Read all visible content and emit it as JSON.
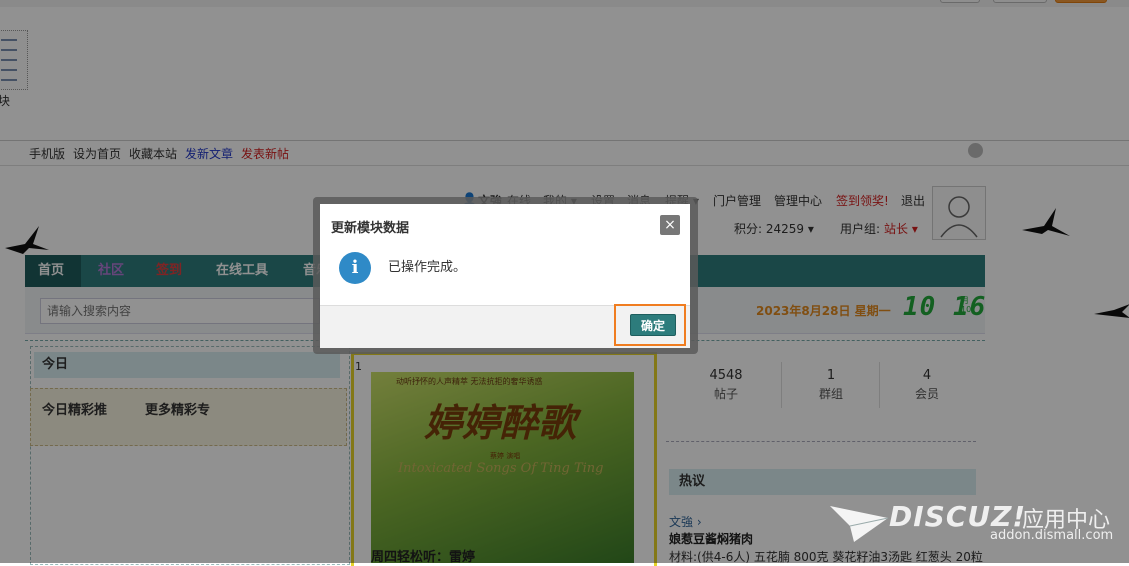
{
  "diy_panel": {
    "block_label": "块"
  },
  "quickbar": {
    "links": [
      "手机版",
      "设为首页",
      "收藏本站"
    ],
    "post_article": "发新文章",
    "post_thread": "发表新帖"
  },
  "user_bar": {
    "username": "文強",
    "status": "在线",
    "mine": "我的 ▾",
    "settings": "设置",
    "messages": "消息",
    "reminders": "提醒 ▾",
    "portal_manage": "门户管理",
    "admin_center": "管理中心",
    "checkin": "签到领奖!",
    "logout": "退出",
    "points": "积分: 24259 ▾",
    "usergroup_label": "用户组:",
    "usergroup": "站长 ▾"
  },
  "nav": {
    "items": [
      "首页",
      "社区",
      "签到",
      "在线工具",
      "音乐"
    ]
  },
  "search": {
    "placeholder": "请输入搜索内容"
  },
  "date": {
    "text": "2023年8月28日 星期一",
    "clock": "10 16",
    "clock_suffix": "月\n10"
  },
  "left_col": {
    "today": "今日",
    "tabs": [
      "今日精彩推",
      "更多精彩专"
    ]
  },
  "slide": {
    "index": "1",
    "tagline": "动听抒怀的人声精萃 无法抗拒的奢华诱惑",
    "title": "婷婷醉歌",
    "small": "蔡婷 演唱",
    "subtitle": "Intoxicated Songs Of Ting Ting",
    "caption": "周四轻松听：雷婷"
  },
  "stats": [
    {
      "num": "4548",
      "label": "帖子"
    },
    {
      "num": "1",
      "label": "群组"
    },
    {
      "num": "4",
      "label": "会员"
    }
  ],
  "hot": {
    "header": "热议",
    "author": "文強 ›",
    "title": "娘惹豆酱焖猪肉",
    "body": "材料:(供4-6人) 五花腩 800克 葵花籽油3汤匙 红葱头 20粒"
  },
  "dialog": {
    "title": "更新模块数据",
    "close": "×",
    "icon": "info-icon",
    "message": "已操作完成。",
    "ok": "确定"
  },
  "watermark": {
    "brand": "DISCUZ!",
    "app_center": "应用中心",
    "url": "addon.dismall.com"
  },
  "colors": {
    "nav": "#2f7d7d",
    "ok_button": "#2d7c7c",
    "highlight": "#f07d20",
    "info": "#2f8ac7",
    "date": "#e28a1e",
    "clock": "#22a93a"
  }
}
